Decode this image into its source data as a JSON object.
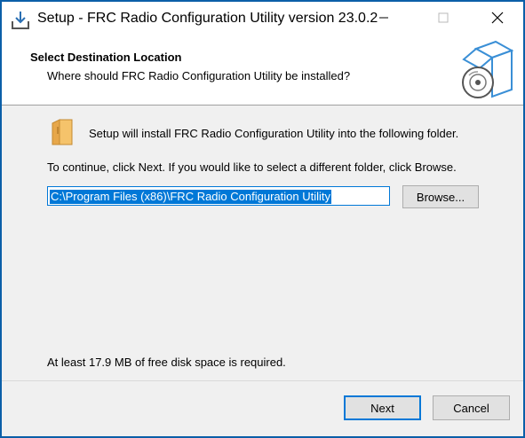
{
  "window": {
    "title": "Setup - FRC Radio Configuration Utility version 23.0.2",
    "border_color": "#0b5fa8",
    "icons": {
      "app": "setup-download-icon",
      "minimize": "minimize-icon",
      "maximize": "maximize-icon",
      "close": "close-icon"
    }
  },
  "header": {
    "title": "Select Destination Location",
    "subtitle": "Where should FRC Radio Configuration Utility be installed?",
    "graphic": "install-box-disc-icon"
  },
  "body": {
    "folder_icon": "folder-icon",
    "install_text": "Setup will install FRC Radio Configuration Utility into the following folder.",
    "continue_text": "To continue, click Next. If you would like to select a different folder, click Browse.",
    "path_value": "C:\\Program Files (x86)\\FRC Radio Configuration Utility",
    "browse_label": "Browse...",
    "disk_space_text": "At least 17.9 MB of free disk space is required."
  },
  "footer": {
    "next_label": "Next",
    "cancel_label": "Cancel"
  },
  "colors": {
    "accent": "#0078d7",
    "selection_bg": "#0078d7",
    "folder": "#f5c36b"
  }
}
